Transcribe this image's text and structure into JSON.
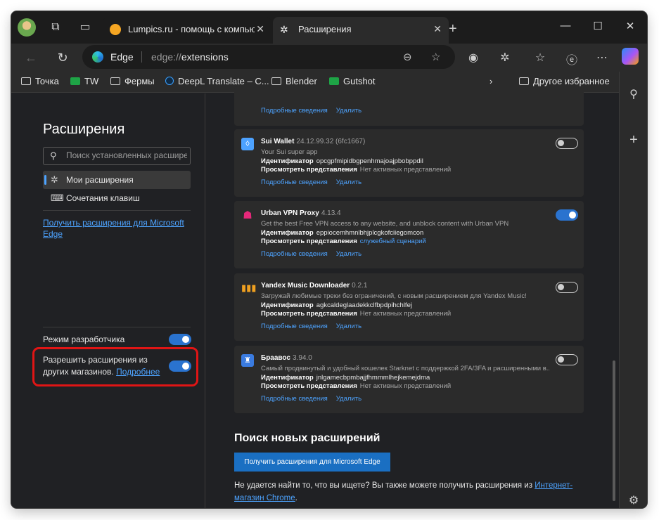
{
  "titlebar": {
    "tabs": [
      {
        "title": "Lumpics.ru - помощь с компьюте",
        "close": "✕"
      },
      {
        "title": "Расширения",
        "close": "✕"
      }
    ],
    "new_tab": "+",
    "minimize": "—",
    "maximize": "☐",
    "close": "✕"
  },
  "toolbar": {
    "omnibox_brand": "Edge",
    "url_scheme": "edge://",
    "url_path": "extensions"
  },
  "bookmarks": [
    {
      "label": "Точка",
      "icon": "folder-icon"
    },
    {
      "label": "TW",
      "icon": "green-cross-icon"
    },
    {
      "label": "Фермы",
      "icon": "folder-icon"
    },
    {
      "label": "DeepL Translate – C...",
      "icon": "deepl-icon"
    },
    {
      "label": "Blender",
      "icon": "folder-icon"
    },
    {
      "label": "Gutshot",
      "icon": "green-cross-icon"
    }
  ],
  "bookmarks_other": "Другое избранное",
  "nav": {
    "title": "Расширения",
    "search_placeholder": "Поиск установленных расшире...",
    "items": [
      {
        "label": "Мои расширения",
        "active": true,
        "icon": "puzzle-icon"
      },
      {
        "label": "Сочетания клавиш",
        "active": false,
        "icon": "keyboard-icon"
      }
    ],
    "store_link": "Получить расширения для Microsoft Edge",
    "developer_mode": {
      "label": "Режим разработчика",
      "on": true
    },
    "allow_other_stores": {
      "label": "Разрешить расширения из других магазинов.",
      "link": "Подробнее",
      "on": true
    }
  },
  "extensions": [
    {
      "name": "",
      "version": "",
      "description": "",
      "id_label": "",
      "id": "",
      "views_label": "",
      "views": "",
      "details": "Подробные сведения",
      "remove": "Удалить",
      "enabled": null
    },
    {
      "name": "Sui Wallet",
      "version": "24.12.99.32 (6fc1667)",
      "description": "Your Sui super app",
      "id_label": "Идентификатор",
      "id": "opcgpfmipidbgpenhmajoajpbobppdil",
      "views_label": "Просмотреть представления",
      "views": "Нет активных представлений",
      "details": "Подробные сведения",
      "remove": "Удалить",
      "enabled": false,
      "icon_color": "#4da2ff"
    },
    {
      "name": "Urban VPN Proxy",
      "version": "4.13.4",
      "description": "Get the best Free VPN access to any website, and unblock content with Urban VPN",
      "id_label": "Идентификатор",
      "id": "eppiocemhmnlbhjplcgkofciiegomcon",
      "views_label": "Просмотреть представления",
      "views": "служебный сценарий",
      "details": "Подробные сведения",
      "remove": "Удалить",
      "enabled": true,
      "icon_color": "#e6287a"
    },
    {
      "name": "Yandex Music Downloader",
      "version": "0.2.1",
      "description": "Загружай любимые треки без ограничений, с новым расширением для Yandex Music!",
      "id_label": "Идентификатор",
      "id": "agkcaldeglaadekkclfbpdpihchlfej",
      "views_label": "Просмотреть представления",
      "views": "Нет активных представлений",
      "details": "Подробные сведения",
      "remove": "Удалить",
      "enabled": false,
      "icon_color": "#f0a020"
    },
    {
      "name": "Браавос",
      "version": "3.94.0",
      "description": "Самый продвинутый и удобный кошелек Starknet с поддержкой 2FA/3FA и расширенными в...",
      "id_label": "Идентификатор",
      "id": "jnlgamecbpmbajjfhmmmlhejkemejdma",
      "views_label": "Просмотреть представления",
      "views": "Нет активных представлений",
      "details": "Подробные сведения",
      "remove": "Удалить",
      "enabled": false,
      "icon_color": "#3a7be0"
    }
  ],
  "find_more": {
    "title": "Поиск новых расширений",
    "button": "Получить расширения для Microsoft Edge",
    "hint": "Не удается найти то, что вы ищете? Вы также можете получить расширения из",
    "hint_link": "Интернет-магазин Chrome",
    "hint_end": "."
  }
}
